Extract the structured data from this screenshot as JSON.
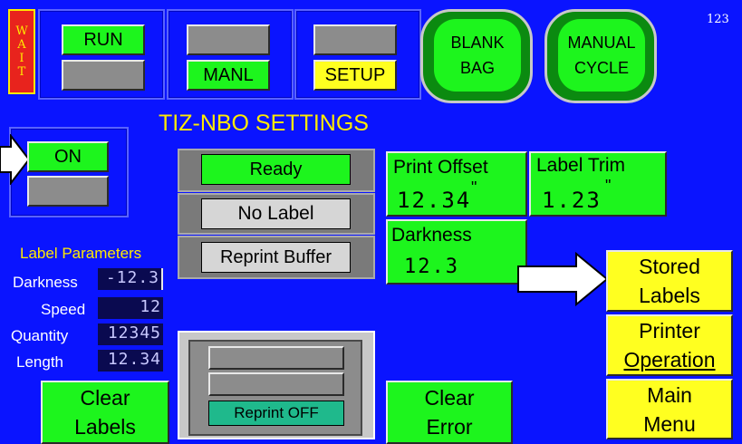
{
  "status": {
    "wait_letters": [
      "W",
      "A",
      "I",
      "T"
    ],
    "counter": "123"
  },
  "mode_buttons": {
    "run": "RUN",
    "manl": "MANL",
    "setup": "SETUP"
  },
  "round_buttons": {
    "blank_bag": [
      "BLANK",
      "BAG"
    ],
    "manual_cycle": [
      "MANUAL",
      "CYCLE"
    ]
  },
  "page_title": "TIZ-NBO SETTINGS",
  "toggle": {
    "on": "ON"
  },
  "printer_status": {
    "ready": "Ready",
    "no_label": "No Label",
    "reprint_buffer": "Reprint Buffer"
  },
  "readouts": {
    "print_offset": {
      "label": "Print Offset",
      "value": "12.34",
      "unit": "\""
    },
    "label_trim": {
      "label": "Label Trim",
      "value": "1.23",
      "unit": "\""
    },
    "darkness": {
      "label": "Darkness",
      "value": "12.3"
    }
  },
  "label_params": {
    "heading": "Label Parameters",
    "rows": [
      {
        "label": "Darkness",
        "value": "-12.3"
      },
      {
        "label": "Speed",
        "value": "12"
      },
      {
        "label": "Quantity",
        "value": "12345"
      },
      {
        "label": "Length",
        "value": "12.34"
      }
    ]
  },
  "reprint": {
    "status": "Reprint OFF"
  },
  "bottom_buttons": {
    "clear_labels": [
      "Clear",
      "Labels"
    ],
    "clear_error": [
      "Clear",
      "Error"
    ]
  },
  "side_menu": {
    "stored_labels": [
      "Stored",
      "Labels"
    ],
    "printer_operation": [
      "Printer",
      "Operation"
    ],
    "main_menu": [
      "Main",
      "Menu"
    ]
  },
  "colors": {
    "background": "#0a14ff",
    "green": "#1df51d",
    "yellow": "#ffff20",
    "wait_red": "#e8231d",
    "reprint_teal": "#1fb98c"
  }
}
